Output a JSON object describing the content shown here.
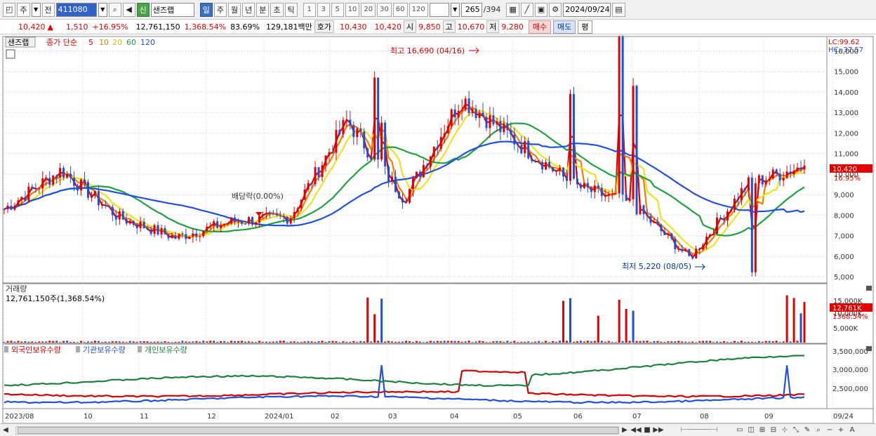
{
  "toolbar": {
    "period_week": "주",
    "prev_label": "전",
    "stock_code": "411080",
    "sin_label": "신",
    "stock_name": "샌즈랩",
    "periods": [
      "일",
      "주",
      "월",
      "년",
      "분",
      "초",
      "틱"
    ],
    "active_period": "일",
    "intervals": [
      "1",
      "3",
      "5",
      "10",
      "20",
      "30",
      "60",
      "120"
    ],
    "bar_count": "265",
    "total_bars": "/394",
    "date": "2024/09/24"
  },
  "infobar": {
    "price": "10,420",
    "up_arrow": "▲",
    "change": "1,510",
    "change_pct": "+16.95%",
    "volume": "12,761,150",
    "volume_pct": "1,368.54%",
    "turnover_pct": "83.69%",
    "amount": "129,181백만",
    "hoga_label": "호가",
    "ask": "10,430",
    "bid": "10,420",
    "open_label": "시",
    "open": "9,850",
    "high_label": "고",
    "high": "10,670",
    "low_label": "저",
    "low": "9,280",
    "buy_label": "매수",
    "sell_label": "매도",
    "avg_label": "평"
  },
  "price_panel": {
    "name_tag": "샌즈랩",
    "legend_prefix": "종가 단순",
    "ma_periods": [
      "5",
      "10",
      "20",
      "60",
      "120"
    ],
    "ma_colors": [
      "#e00000",
      "#f08000",
      "#f0e020",
      "#20a040",
      "#2050e0"
    ],
    "lc_label": "LC:99.62",
    "hc_label": "HC:-37.57",
    "high_annotation": "최고 16,690 (04/16)",
    "low_annotation": "최저 5,220 (08/05)",
    "dividend_annotation": "배당락(0.00%)",
    "last_price_tag": "10,420",
    "last_change_tag": "16.95%",
    "y_ticks": [
      "16,000",
      "15,000",
      "14,000",
      "13,000",
      "12,000",
      "11,000",
      "10,000",
      "9,000",
      "8,000",
      "7,000",
      "6,000",
      "5,000"
    ]
  },
  "volume_panel": {
    "title": "거래량",
    "value_label": "12,761,150주(1,368.54%)",
    "y_ticks": [
      "15,000K",
      "10,000K",
      "5,000K"
    ],
    "last_tag": "12,761K",
    "last_pct": "1368.54%"
  },
  "holding_panel": {
    "legend": [
      "외국인보유수량",
      "기관보유수량",
      "개인보유수량"
    ],
    "legend_colors": [
      "#d00000",
      "#2050e0",
      "#208040"
    ],
    "y_ticks": [
      "3,500,000",
      "3,000,000",
      "2,500,000"
    ]
  },
  "x_axis": {
    "labels": [
      "2023/08",
      "10",
      "11",
      "12",
      "2024/01",
      "02",
      "03",
      "04",
      "05",
      "06",
      "07",
      "08",
      "09",
      "09/24"
    ]
  },
  "chart_data": {
    "type": "candlestick",
    "title": "샌즈랩 (411080) 일봉",
    "ylim": [
      4700,
      16700
    ],
    "close_series": {
      "x": [
        "2023/08",
        "2023/09",
        "2023/10",
        "2023/11",
        "2023/12",
        "2024/01",
        "2024/02",
        "2024/03",
        "2024/04",
        "2024/05",
        "2024/06",
        "2024/07",
        "2024/08",
        "2024/09",
        "2024/09/24"
      ],
      "values": [
        8300,
        10200,
        7900,
        6900,
        7700,
        7900,
        12600,
        8800,
        13700,
        11500,
        9400,
        8500,
        5900,
        9500,
        10420
      ]
    },
    "annotations": [
      {
        "label": "최고",
        "value": 16690,
        "date": "04/16"
      },
      {
        "label": "최저",
        "value": 5220,
        "date": "08/05"
      }
    ],
    "volume_peak_k": 15000,
    "last_volume": 12761150
  },
  "bottom": {
    "zoom_minus": "−",
    "zoom_plus": "+",
    "font_a": "A"
  }
}
